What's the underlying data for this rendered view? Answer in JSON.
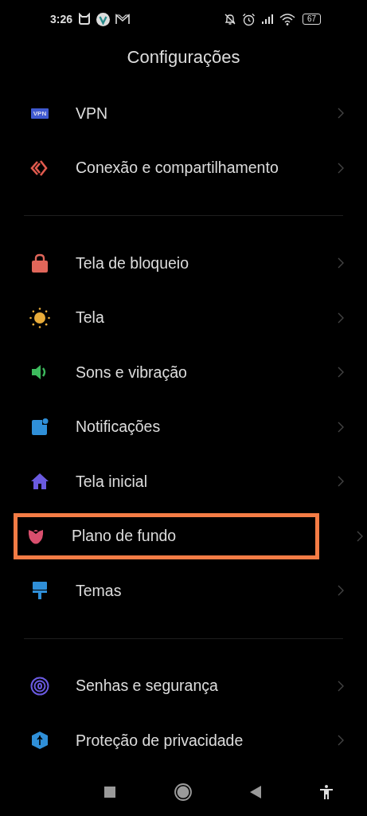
{
  "status_bar": {
    "time": "3:26",
    "battery": "67"
  },
  "title": "Configurações",
  "sections": [
    {
      "items": [
        {
          "kind": "vpn",
          "icon_text": "VPN",
          "label": "VPN",
          "highlighted": false
        },
        {
          "kind": "connection",
          "label": "Conexão e compartilhamento",
          "highlighted": false
        }
      ]
    },
    {
      "items": [
        {
          "kind": "lock",
          "label": "Tela de bloqueio",
          "highlighted": false
        },
        {
          "kind": "sun",
          "label": "Tela",
          "highlighted": false
        },
        {
          "kind": "sound",
          "label": "Sons e vibração",
          "highlighted": false
        },
        {
          "kind": "notification",
          "label": "Notificações",
          "highlighted": false
        },
        {
          "kind": "home",
          "label": "Tela inicial",
          "highlighted": false
        },
        {
          "kind": "flower",
          "label": "Plano de fundo",
          "highlighted": true
        },
        {
          "kind": "brush",
          "label": "Temas",
          "highlighted": false
        }
      ]
    },
    {
      "items": [
        {
          "kind": "fingerprint",
          "label": "Senhas e segurança",
          "highlighted": false
        },
        {
          "kind": "shield",
          "label": "Proteção de privacidade",
          "highlighted": false
        }
      ]
    }
  ]
}
